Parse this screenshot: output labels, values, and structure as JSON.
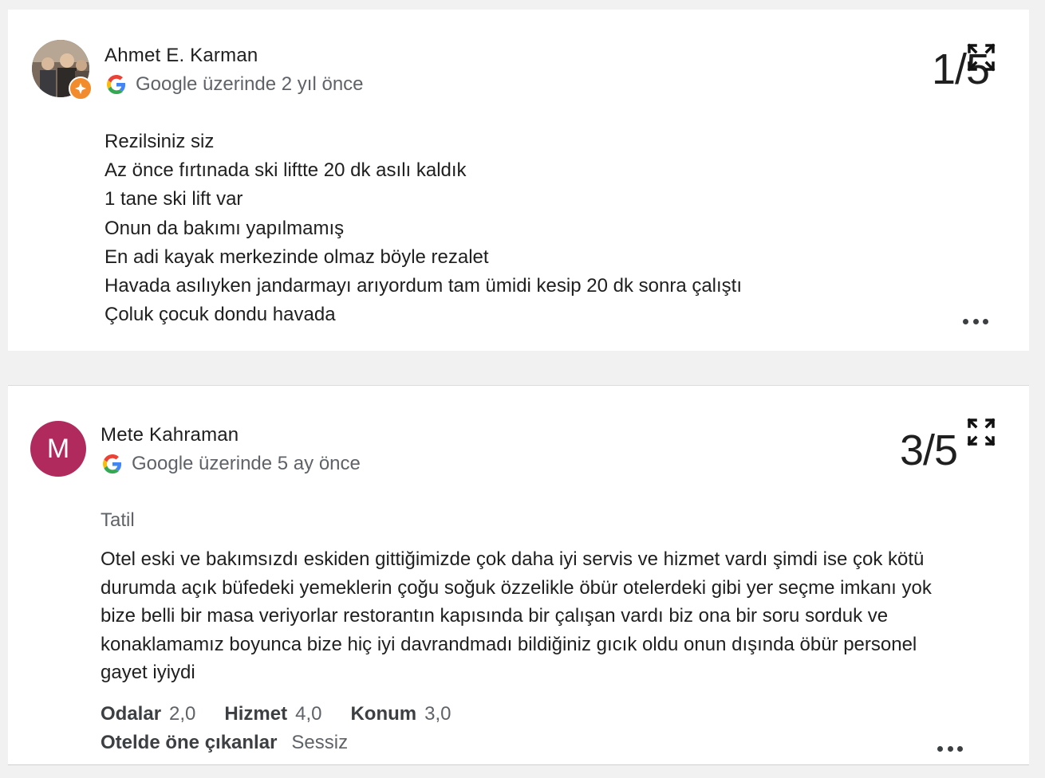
{
  "reviews": [
    {
      "author": "Ahmet E. Karman",
      "meta": "Google üzerinde 2 yıl önce",
      "rating": "1/5",
      "avatar_type": "photo-with-local-guide-badge",
      "lines": [
        "Rezilsiniz siz",
        "Az önce fırtınada ski liftte 20 dk asılı kaldık",
        "1 tane ski lift var",
        "Onun da bakımı yapılmamış",
        "En adi kayak merkezinde olmaz böyle rezalet",
        "Havada asılıyken jandarmayı arıyordum tam ümidi kesip 20 dk sonra çalıştı",
        "Çoluk çocuk dondu havada"
      ]
    },
    {
      "author": "Mete Kahraman",
      "avatar_letter": "M",
      "avatar_color": "#b02a5d",
      "meta": "Google üzerinde 5 ay önce",
      "rating": "3/5",
      "trip_type": "Tatil",
      "text": "Otel eski ve bakımsızdı eskiden gittiğimizde çok daha iyi servis ve hizmet vardı şimdi ise çok kötü durumda açık büfedeki yemeklerin çoğu soğuk özzelikle öbür otelerdeki gibi yer seçme imkanı yok bize belli bir masa veriyorlar restorantın kapısında bir çalışan vardı biz ona bir soru sorduk ve konaklamamız boyunca bize hiç iyi davrandmadı bildiğiniz gıcık oldu onun dışında öbür personel gayet iyiydi",
      "scores": [
        {
          "label": "Odalar",
          "value": "2,0"
        },
        {
          "label": "Hizmet",
          "value": "4,0"
        },
        {
          "label": "Konum",
          "value": "3,0"
        }
      ],
      "highlights_label": "Otelde öne çıkanlar",
      "highlights_value": "Sessiz"
    }
  ],
  "icons": {
    "google": "google-g-icon",
    "expand": "expand-icon",
    "more": "more-options-icon"
  },
  "colors": {
    "google_blue": "#4285F4",
    "google_red": "#EA4335",
    "google_yellow": "#FBBC05",
    "google_green": "#34A853",
    "local_guide_badge": "#f28b2c"
  }
}
